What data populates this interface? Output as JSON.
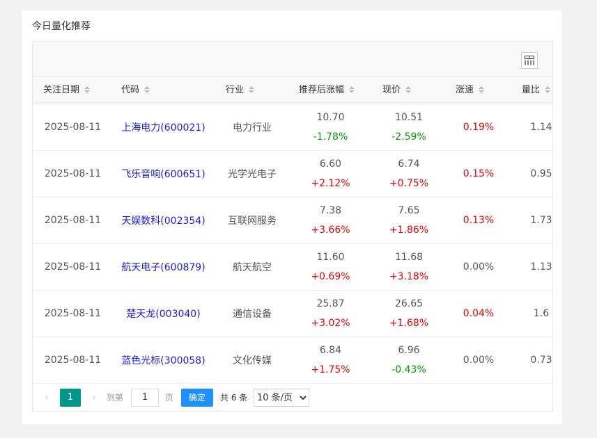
{
  "title": "今日量化推荐",
  "columns": [
    "关注日期",
    "代码",
    "行业",
    "推荐后涨幅",
    "现价",
    "涨速",
    "量比"
  ],
  "rows": [
    {
      "date": "2025-08-11",
      "code": "上海电力(600021)",
      "industry": "电力行业",
      "rec_price": "10.70",
      "rec_change": "-1.78%",
      "rec_dir": "down",
      "cur_price": "10.51",
      "cur_change": "-2.59%",
      "cur_dir": "down",
      "speed": "0.19%",
      "speed_dir": "up",
      "volratio": "1.14"
    },
    {
      "date": "2025-08-11",
      "code": "飞乐音响(600651)",
      "industry": "光学光电子",
      "rec_price": "6.60",
      "rec_change": "+2.12%",
      "rec_dir": "up",
      "cur_price": "6.74",
      "cur_change": "+0.75%",
      "cur_dir": "up",
      "speed": "0.15%",
      "speed_dir": "up",
      "volratio": "0.95"
    },
    {
      "date": "2025-08-11",
      "code": "天娱数科(002354)",
      "industry": "互联网服务",
      "rec_price": "7.38",
      "rec_change": "+3.66%",
      "rec_dir": "up",
      "cur_price": "7.65",
      "cur_change": "+1.86%",
      "cur_dir": "up",
      "speed": "0.13%",
      "speed_dir": "up",
      "volratio": "1.73"
    },
    {
      "date": "2025-08-11",
      "code": "航天电子(600879)",
      "industry": "航天航空",
      "rec_price": "11.60",
      "rec_change": "+0.69%",
      "rec_dir": "up",
      "cur_price": "11.68",
      "cur_change": "+3.18%",
      "cur_dir": "up",
      "speed": "0.00%",
      "speed_dir": "flat",
      "volratio": "1.13"
    },
    {
      "date": "2025-08-11",
      "code": "楚天龙(003040)",
      "industry": "通信设备",
      "rec_price": "25.87",
      "rec_change": "+3.02%",
      "rec_dir": "up",
      "cur_price": "26.65",
      "cur_change": "+1.68%",
      "cur_dir": "up",
      "speed": "0.04%",
      "speed_dir": "up",
      "volratio": "1.6"
    },
    {
      "date": "2025-08-11",
      "code": "蓝色光标(300058)",
      "industry": "文化传媒",
      "rec_price": "6.84",
      "rec_change": "+1.75%",
      "rec_dir": "up",
      "cur_price": "6.96",
      "cur_change": "-0.43%",
      "cur_dir": "down",
      "speed": "0.00%",
      "speed_dir": "flat",
      "volratio": "0.73"
    }
  ],
  "pager": {
    "current": "1",
    "goto_label": "到第",
    "page_input": "1",
    "page_label": "页",
    "confirm": "确定",
    "total": "共 6 条",
    "page_size": "10 条/页"
  },
  "colors": {
    "up": "#e00000",
    "down": "#009900",
    "link": "#1a1aee",
    "accent": "#009688",
    "confirm": "#1e90ff"
  },
  "icons": {
    "columns": "columns-icon",
    "sort": "sort-icon",
    "prev": "chevron-left-icon",
    "next": "chevron-right-icon"
  }
}
